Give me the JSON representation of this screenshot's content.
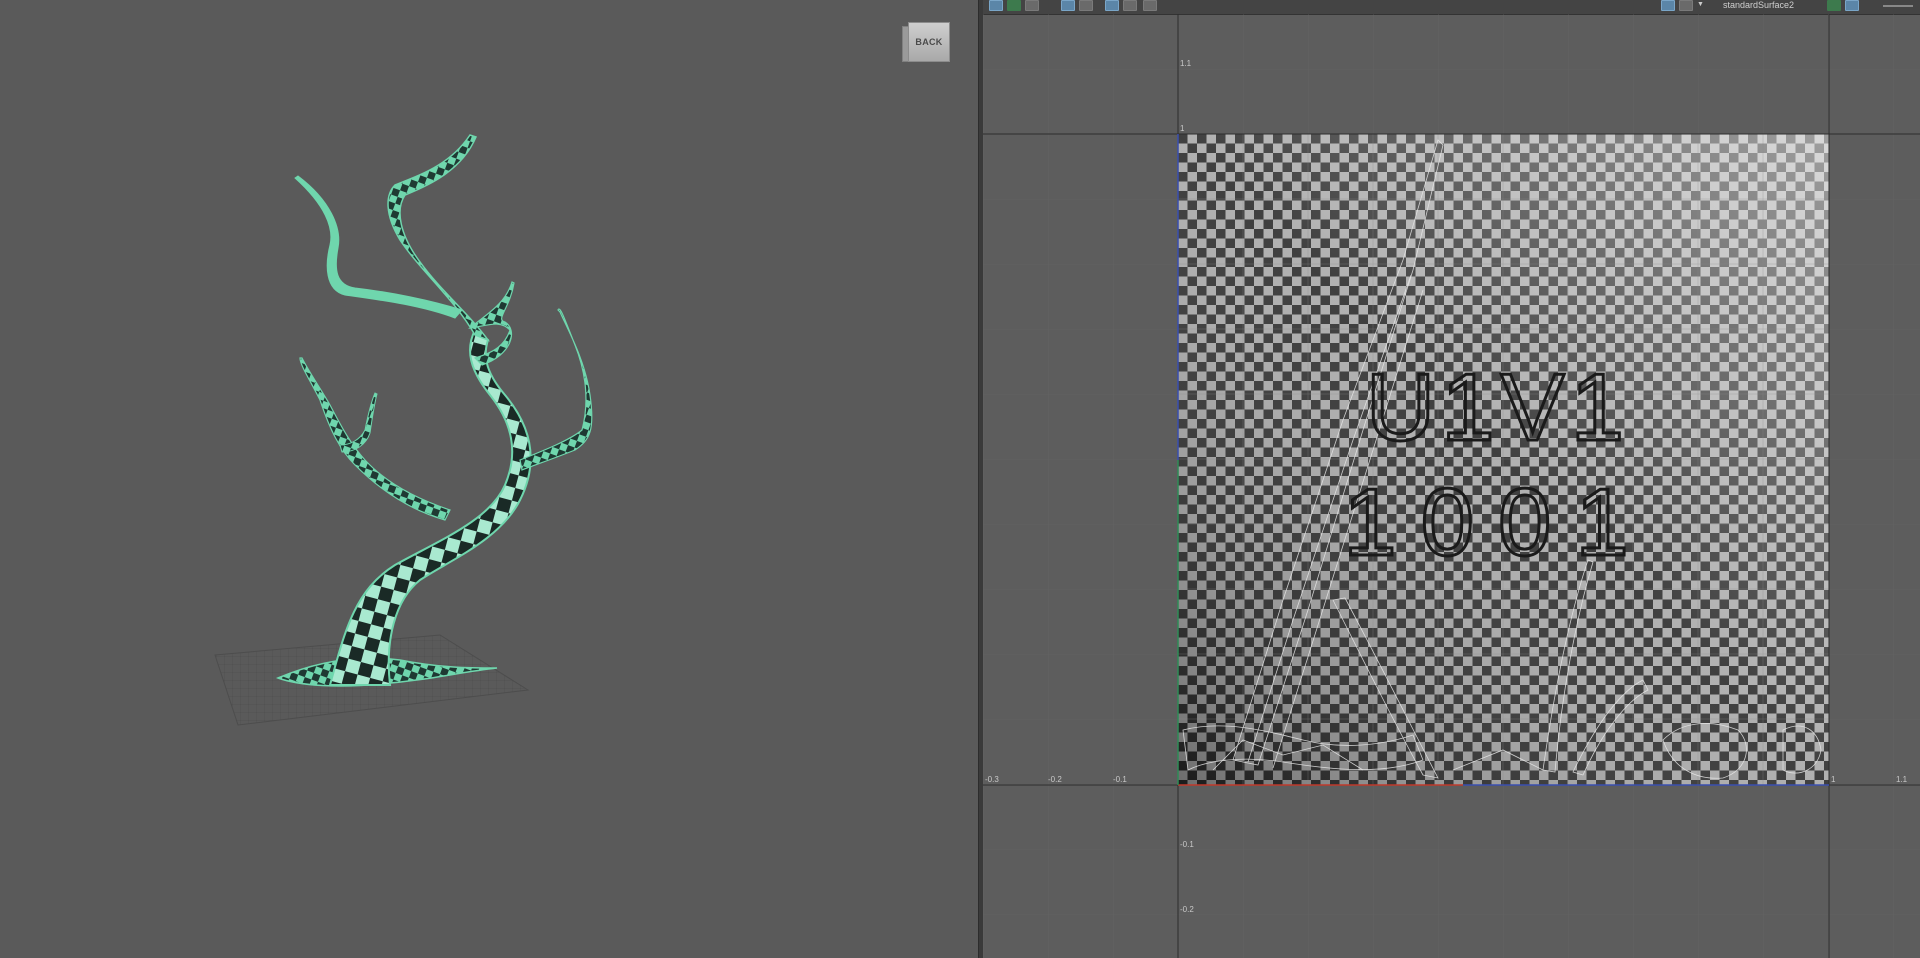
{
  "viewport": {
    "cube_label": "BACK"
  },
  "uv_editor": {
    "toolbar": {
      "shader_name": "standardSurface2"
    },
    "tile_label_line1": "U1V1",
    "tile_label_line2": "1001",
    "axis_labels": {
      "u": [
        "-0.3",
        "-0.2",
        "-0.1",
        "1",
        "1.1"
      ],
      "v": [
        "1.1",
        "1",
        "-0.1",
        "-0.2"
      ]
    }
  },
  "colors": {
    "viewport_bg": "#5a5a5a",
    "selection_green": "#6fd6ad",
    "u_axis": "#c0392b",
    "v_axis": "#2e8b57"
  }
}
